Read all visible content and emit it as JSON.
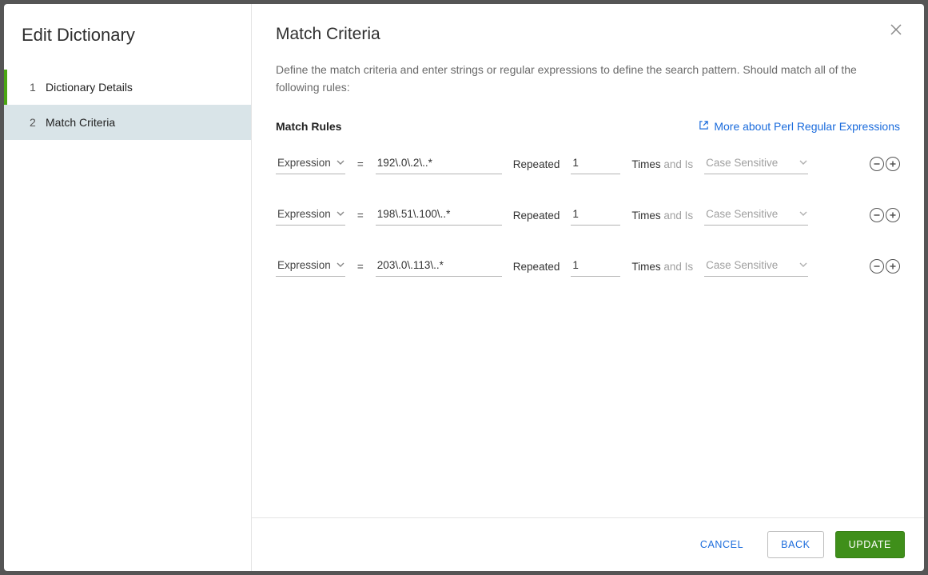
{
  "sidebar": {
    "title": "Edit Dictionary",
    "steps": [
      {
        "num": "1",
        "label": "Dictionary Details",
        "active_indicator": true,
        "selected": false
      },
      {
        "num": "2",
        "label": "Match Criteria",
        "active_indicator": false,
        "selected": true
      }
    ]
  },
  "main": {
    "title": "Match Criteria",
    "description": "Define the match criteria and enter strings or regular expressions to define the search pattern. Should match all of the following rules:",
    "rules_title": "Match Rules",
    "help_link_label": "More about Perl Regular Expressions"
  },
  "labels": {
    "equals": "=",
    "repeated": "Repeated",
    "times": "Times",
    "and_is": "and Is"
  },
  "placeholders": {
    "case": "Case Sensitive"
  },
  "rules": [
    {
      "type_label": "Expression",
      "pattern": "192\\.0\\.2\\..*",
      "count": "1",
      "case_value": ""
    },
    {
      "type_label": "Expression",
      "pattern": "198\\.51\\.100\\..*",
      "count": "1",
      "case_value": ""
    },
    {
      "type_label": "Expression",
      "pattern": "203\\.0\\.113\\..*",
      "count": "1",
      "case_value": ""
    }
  ],
  "footer": {
    "cancel": "CANCEL",
    "back": "BACK",
    "update": "UPDATE"
  }
}
